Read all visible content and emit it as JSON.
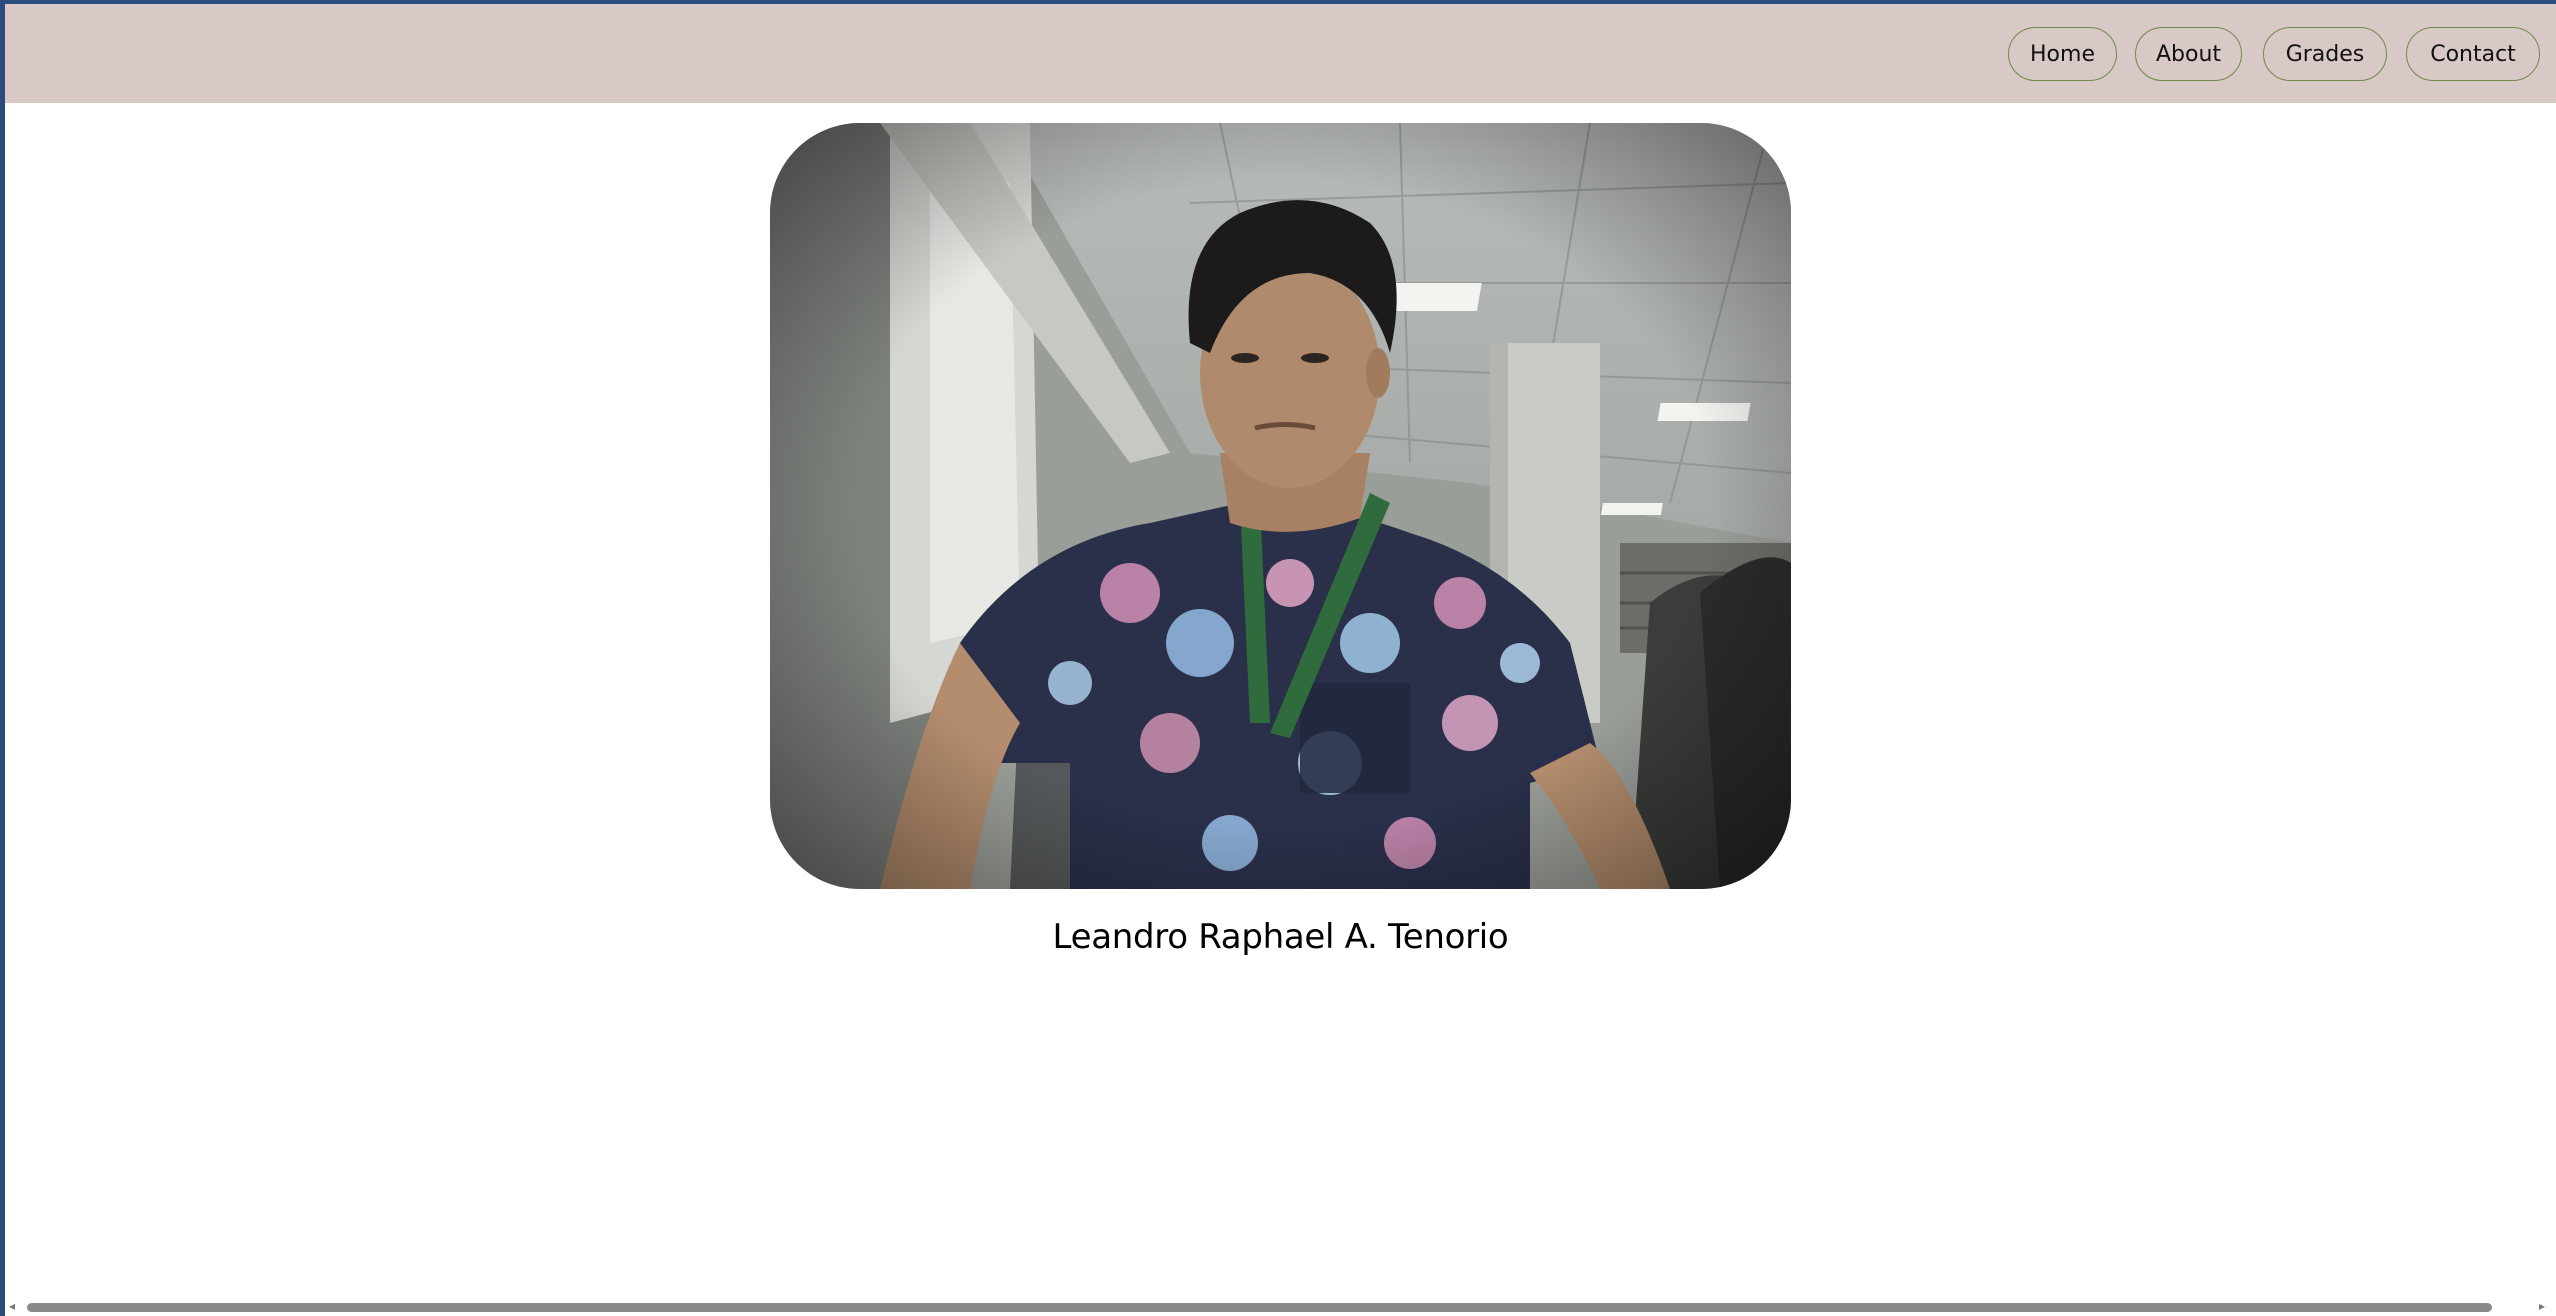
{
  "nav": {
    "items": [
      {
        "label": "Home"
      },
      {
        "label": "About"
      },
      {
        "label": "Grades"
      },
      {
        "label": "Contact"
      }
    ]
  },
  "profile": {
    "name": "Leandro Raphael A. Tenorio"
  },
  "colors": {
    "navbar_bg": "#d8c8c6",
    "nav_border": "#6f8a4f",
    "page_bg": "#ffffff",
    "window_frame": "#2b4a7e"
  },
  "icons": {
    "scroll_left": "scroll-left-arrow-icon",
    "scroll_right": "scroll-right-arrow-icon"
  }
}
